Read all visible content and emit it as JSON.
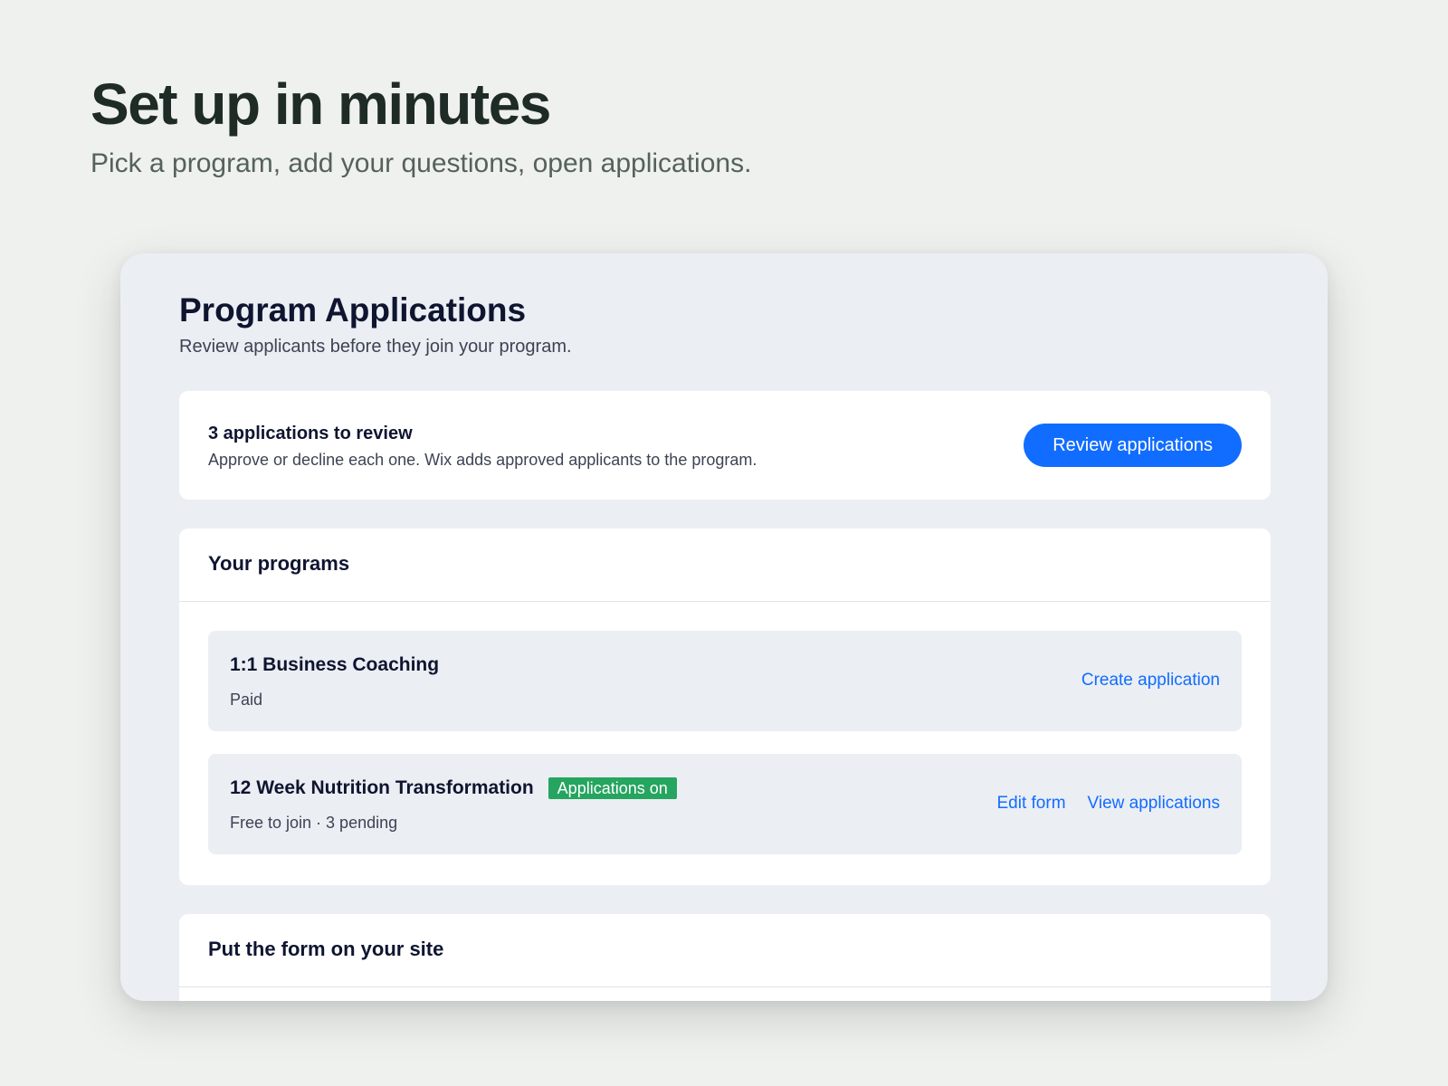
{
  "hero": {
    "title": "Set up in minutes",
    "subtitle": "Pick a program, add your questions, open applications."
  },
  "app": {
    "title": "Program Applications",
    "subtitle": "Review applicants before they join your program."
  },
  "review": {
    "heading": "3 applications to review",
    "description": "Approve or decline each one. Wix adds approved applicants to the program.",
    "button_label": "Review applications"
  },
  "programs": {
    "title": "Your programs",
    "items": [
      {
        "name": "1:1 Business Coaching",
        "meta": "Paid",
        "actions": [
          "Create application"
        ]
      },
      {
        "name": "12 Week Nutrition Transformation",
        "badge": "Applications on",
        "meta": "Free to join · 3 pending",
        "actions": [
          "Edit form",
          "View applications"
        ]
      }
    ]
  },
  "embed": {
    "title": "Put the form on your site"
  },
  "colors": {
    "accent": "#116dff",
    "badge": "#25a55f",
    "page_bg": "#eff1ef",
    "card_bg": "#ebeef3"
  }
}
